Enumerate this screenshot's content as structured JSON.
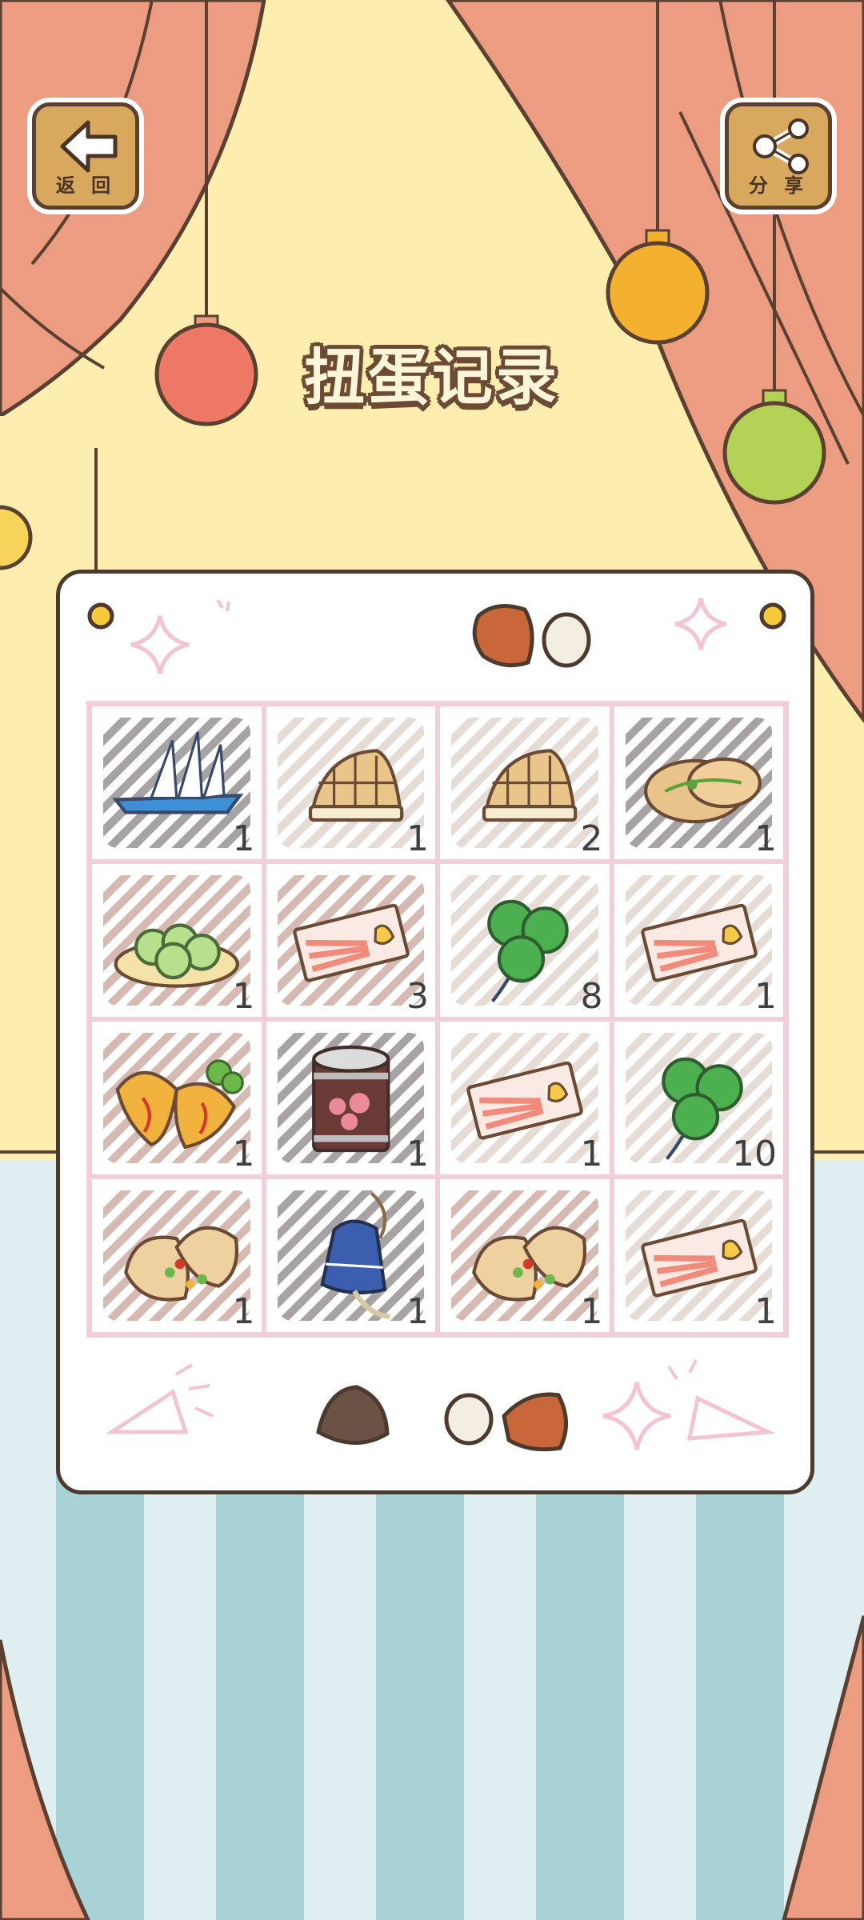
{
  "header": {
    "title": "扭蛋记录",
    "back_label": "返 回",
    "share_label": "分 享"
  },
  "colors": {
    "curtain": "#ec9c80",
    "wall": "#fdeeb0",
    "floor_light": "#dfeef0",
    "floor_stripe": "#a9d2d6",
    "hatch_dark": "#8a8384",
    "hatch_brown": "#c8a296",
    "hatch_light": "#ddd0c8",
    "grid_border": "#f1cfd9"
  },
  "capsule_records": [
    {
      "item": "paper-boat",
      "count": "1",
      "hatch": "dark"
    },
    {
      "item": "waffle-sandwich",
      "count": "1",
      "hatch": "light"
    },
    {
      "item": "waffle-sandwich",
      "count": "2",
      "hatch": "light"
    },
    {
      "item": "flatbread",
      "count": "1",
      "hatch": "dark"
    },
    {
      "item": "dumplings-plate",
      "count": "1",
      "hatch": "brown"
    },
    {
      "item": "ticket",
      "count": "3",
      "hatch": "brown"
    },
    {
      "item": "clover",
      "count": "8",
      "hatch": "light"
    },
    {
      "item": "ticket",
      "count": "1",
      "hatch": "light"
    },
    {
      "item": "empanada",
      "count": "1",
      "hatch": "brown"
    },
    {
      "item": "canned-food",
      "count": "1",
      "hatch": "dark"
    },
    {
      "item": "ticket",
      "count": "1",
      "hatch": "light"
    },
    {
      "item": "clover",
      "count": "10",
      "hatch": "light"
    },
    {
      "item": "pita-bread",
      "count": "1",
      "hatch": "brown"
    },
    {
      "item": "wind-bell",
      "count": "1",
      "hatch": "dark"
    },
    {
      "item": "pita-bread",
      "count": "1",
      "hatch": "brown"
    },
    {
      "item": "ticket",
      "count": "1",
      "hatch": "light"
    }
  ]
}
